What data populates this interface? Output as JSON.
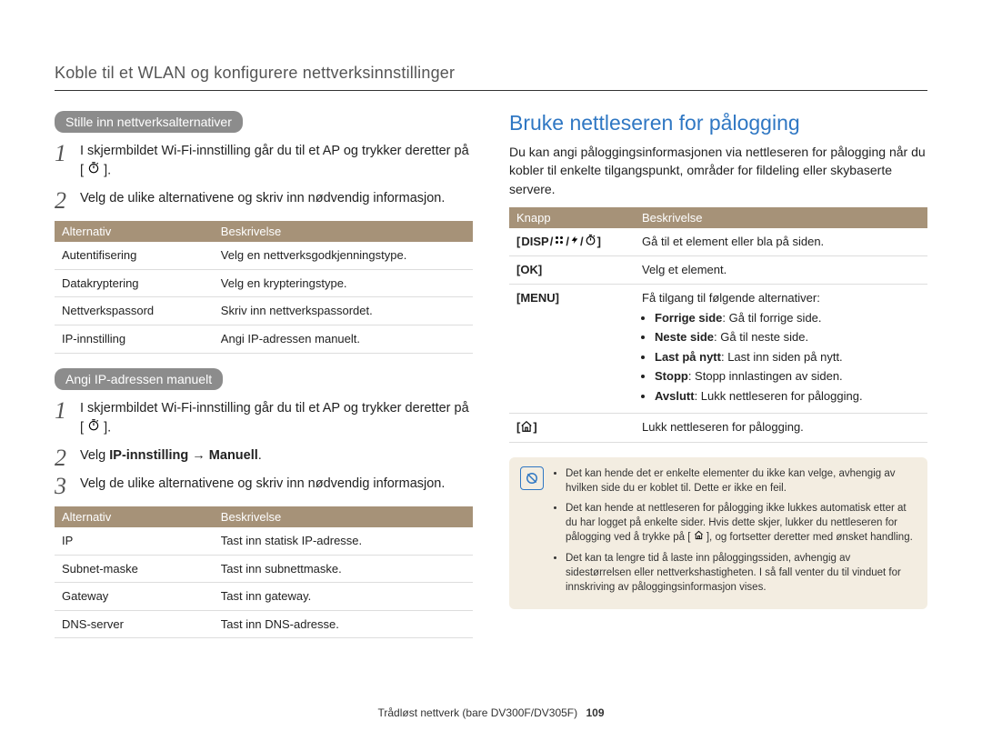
{
  "header": "Koble til et WLAN og konfigurere nettverksinnstillinger",
  "left": {
    "tag1": "Stille inn nettverksalternativer",
    "steps1": [
      "I skjermbildet Wi-Fi-innstilling går du til et AP og trykker deretter på [",
      "Velg de ulike alternativene og skriv inn nødvendig informasjon."
    ],
    "steps1_suffix": "].",
    "table1": {
      "h1": "Alternativ",
      "h2": "Beskrivelse",
      "rows": [
        {
          "a": "Autentifisering",
          "b": "Velg en nettverksgodkjenningstype."
        },
        {
          "a": "Datakryptering",
          "b": "Velg en krypteringstype."
        },
        {
          "a": "Nettverkspassord",
          "b": "Skriv inn nettverkspassordet."
        },
        {
          "a": "IP-innstilling",
          "b": "Angi IP-adressen manuelt."
        }
      ]
    },
    "tag2": "Angi IP-adressen manuelt",
    "steps2": {
      "s1_pre": "I skjermbildet Wi-Fi-innstilling går du til et AP og trykker deretter på [",
      "s1_suf": "].",
      "s2_pre": "Velg ",
      "s2_bold": "IP-innstilling → Manuell",
      "s2_suf": ".",
      "s3": "Velg de ulike alternativene og skriv inn nødvendig informasjon."
    },
    "table2": {
      "h1": "Alternativ",
      "h2": "Beskrivelse",
      "rows": [
        {
          "a": "IP",
          "b": "Tast inn statisk IP-adresse."
        },
        {
          "a": "Subnet-maske",
          "b": "Tast inn subnettmaske."
        },
        {
          "a": "Gateway",
          "b": "Tast inn gateway."
        },
        {
          "a": "DNS-server",
          "b": "Tast inn DNS-adresse."
        }
      ]
    }
  },
  "right": {
    "title": "Bruke nettleseren for pålogging",
    "intro": "Du kan angi påloggingsinformasjonen via nettleseren for pålogging når du kobler til enkelte tilgangspunkt, områder for fildeling eller skybaserte servere.",
    "table": {
      "h1": "Knapp",
      "h2": "Beskrivelse",
      "row1": {
        "key": "DISP",
        "sep": "/",
        "desc": "Gå til et element eller bla på siden."
      },
      "row2": {
        "key": "OK",
        "desc": "Velg et element."
      },
      "row3": {
        "key": "MENU",
        "intro": "Få tilgang til følgende alternativer:",
        "items": [
          {
            "b": "Forrige side",
            "t": ": Gå til forrige side."
          },
          {
            "b": "Neste side",
            "t": ": Gå til neste side."
          },
          {
            "b": "Last på nytt",
            "t": ": Last inn siden på nytt."
          },
          {
            "b": "Stopp",
            "t": ": Stopp innlastingen av siden."
          },
          {
            "b": "Avslutt",
            "t": ": Lukk nettleseren for pålogging."
          }
        ]
      },
      "row4": {
        "desc": "Lukk nettleseren for pålogging."
      }
    },
    "notes": [
      "Det kan hende det er enkelte elementer du ikke kan velge, avhengig av hvilken side du er koblet til. Dette er ikke en feil.",
      {
        "pre": "Det kan hende at nettleseren for pålogging ikke lukkes automatisk etter at du har logget på enkelte sider. Hvis dette skjer, lukker du nettleseren for pålogging ved å trykke på [",
        "suf": "], og fortsetter deretter med ønsket handling."
      },
      "Det kan ta lengre tid å laste inn påloggingssiden, avhengig av sidestørrelsen eller nettverkshastigheten. I så fall venter du til vinduet for innskriving av påloggingsinformasjon vises."
    ]
  },
  "footer": {
    "text": "Trådløst nettverk (bare DV300F/DV305F)",
    "page": "109"
  }
}
